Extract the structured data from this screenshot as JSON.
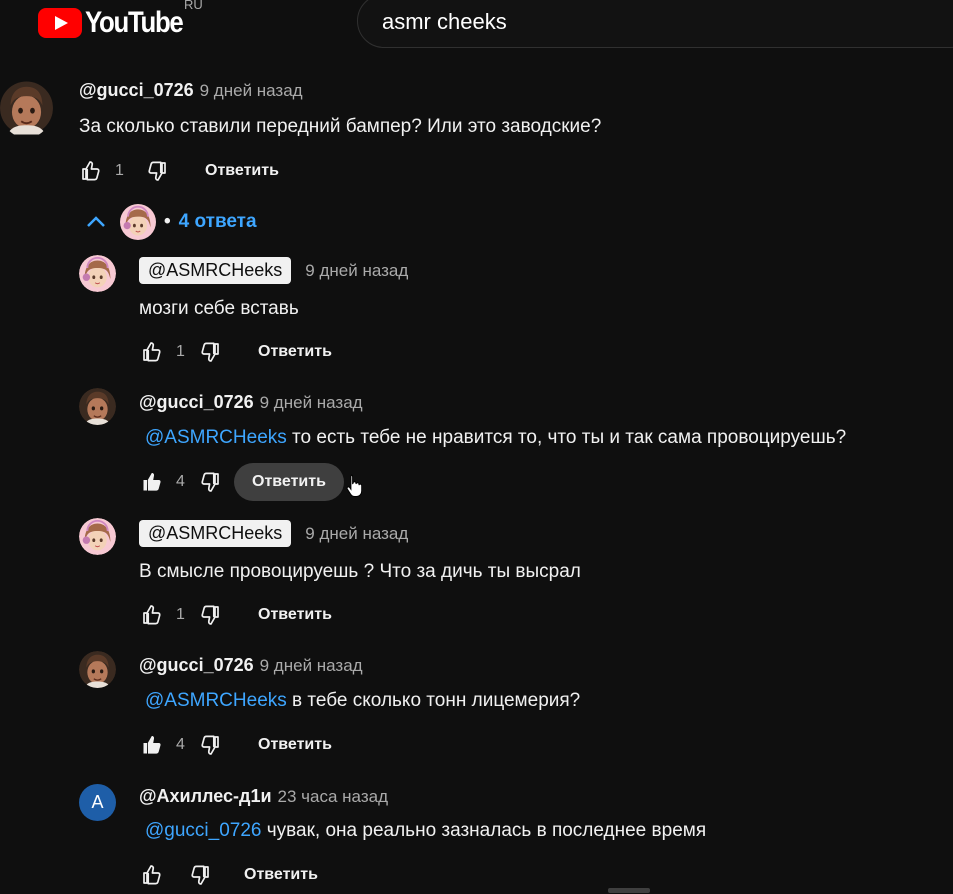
{
  "header": {
    "logo_text": "YouTube",
    "region": "RU",
    "search_value": "asmr cheeks"
  },
  "comment": {
    "author": "@gucci_0726",
    "time": "9 дней назад",
    "text": "За сколько ставили передний бампер? Или это заводские?",
    "likes": "1",
    "reply_label": "Ответить"
  },
  "replies_toggle": {
    "dot": "•",
    "label": "4 ответа"
  },
  "replies": [
    {
      "author": "@ASMRCHeeks",
      "time": "9 дней назад",
      "mention": "",
      "text": "мозги себе вставь",
      "likes": "1",
      "reply_label": "Ответить"
    },
    {
      "author": "@gucci_0726",
      "time": "9 дней назад",
      "mention": "@ASMRCHeeks",
      "text": " то есть тебе не нравится то, что ты и так сама провоцируешь?",
      "likes": "4",
      "reply_label": "Ответить"
    },
    {
      "author": "@ASMRCHeeks",
      "time": "9 дней назад",
      "mention": "",
      "text": "В смысле провоцируешь ? Что за дичь ты высрал",
      "likes": "1",
      "reply_label": "Ответить"
    },
    {
      "author": "@gucci_0726",
      "time": "9 дней назад",
      "mention": "@ASMRCHeeks",
      "text": " в тебе сколько тонн лицемерия?",
      "likes": "4",
      "reply_label": "Ответить"
    },
    {
      "author": "@Ахиллес-д1и",
      "time": "23 часа назад",
      "mention": "@gucci_0726",
      "text": " чувак, она реально зазналась в последнее время",
      "likes": "",
      "reply_label": "Ответить",
      "avatar_letter": "A"
    }
  ],
  "colors": {
    "link": "#3ea6ff",
    "bg": "#0f0f0f",
    "brand": "#ff0000"
  }
}
